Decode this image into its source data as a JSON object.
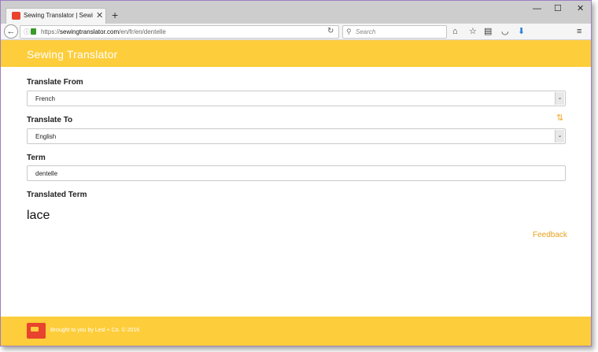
{
  "browser": {
    "tab_title": "Sewing Translator | Sewin...",
    "tab_close": "✕",
    "new_tab": "+",
    "window_controls": {
      "minimize": "—",
      "maximize": "☐",
      "close": "✕"
    },
    "back_glyph": "←",
    "url_prefix": "https://",
    "url_domain": "sewingtranslator.com",
    "url_path": "/en/fr/en/dentelle",
    "search_placeholder": "Search",
    "icons": [
      "home-icon",
      "star-icon",
      "reading-list-icon",
      "pocket-icon",
      "download-icon",
      "menu-icon"
    ]
  },
  "header": {
    "brand": "Sewing Translator"
  },
  "form": {
    "from_label": "Translate From",
    "from_value": "French",
    "to_label": "Translate To",
    "to_value": "English",
    "swap_glyph": "⇅",
    "term_label": "Term",
    "term_value": "dentelle",
    "translated_label": "Translated Term",
    "translated_value": "lace"
  },
  "links": {
    "feedback": "Feedback"
  },
  "footer": {
    "credit": "Brought to you by Lesl + Co. © 2016"
  },
  "colors": {
    "accent": "#fdcd3b",
    "link": "#e8a31d",
    "logo": "#e8432e"
  }
}
